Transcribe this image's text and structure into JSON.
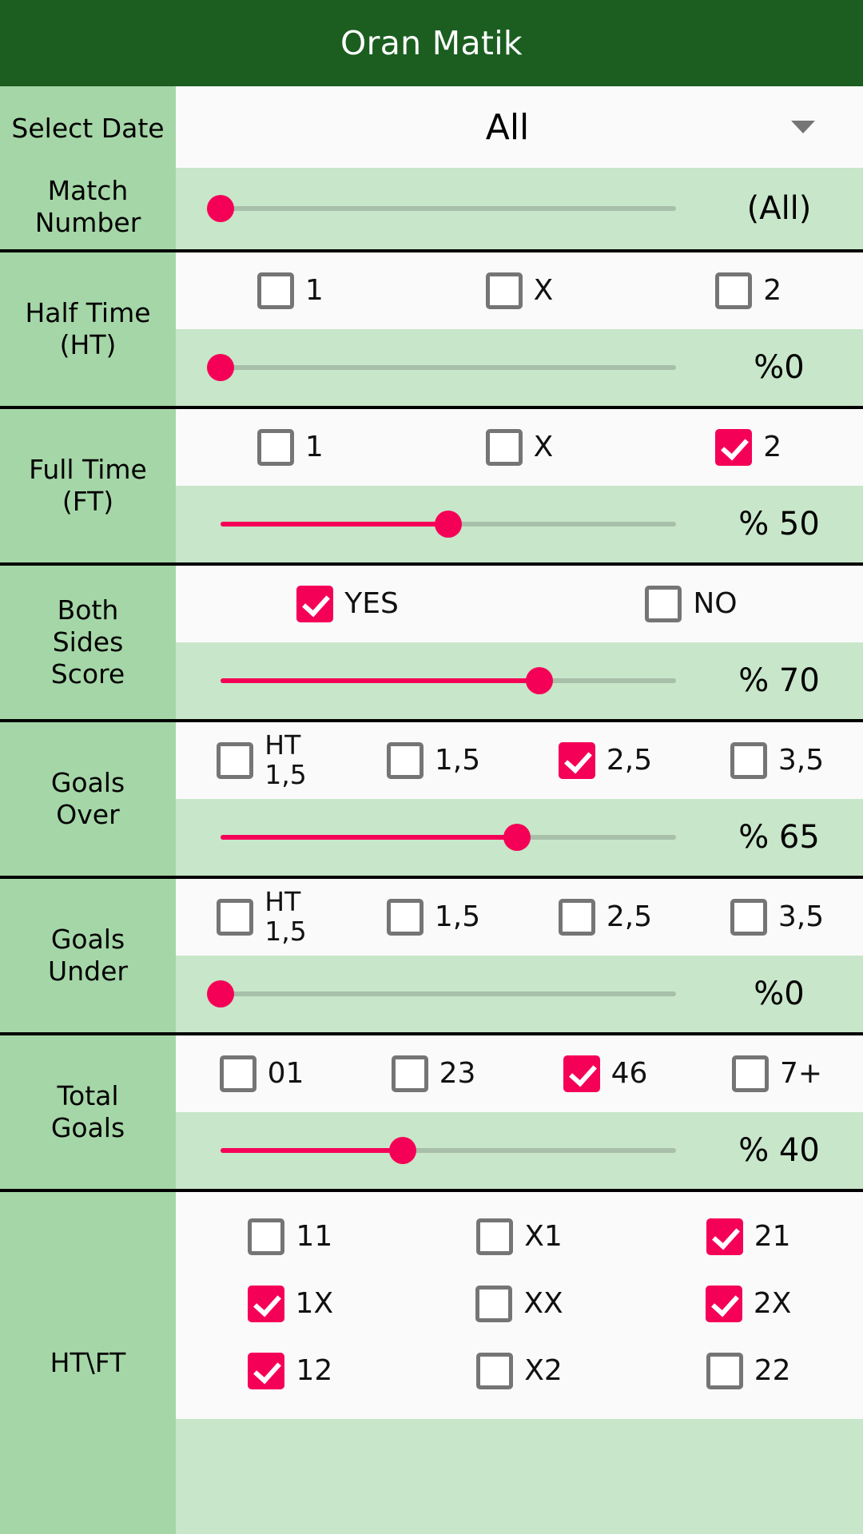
{
  "appbar": {
    "title": "Oran Matik"
  },
  "sections": {
    "select_date": {
      "label": "Select\nDate",
      "dropdown_value": "All",
      "caret_icon": "chevron-down-icon"
    },
    "match_number": {
      "label": "Match\nNumber",
      "slider_value_text": "(All)",
      "slider_percent": 0
    },
    "half_time": {
      "label": "Half Time\n(HT)",
      "options": [
        {
          "label": "1",
          "checked": false
        },
        {
          "label": "X",
          "checked": false
        },
        {
          "label": "2",
          "checked": false
        }
      ],
      "slider_value_text": "%0",
      "slider_percent": 0
    },
    "full_time": {
      "label": "Full Time\n(FT)",
      "options": [
        {
          "label": "1",
          "checked": false
        },
        {
          "label": "X",
          "checked": false
        },
        {
          "label": "2",
          "checked": true
        }
      ],
      "slider_value_text": "% 50",
      "slider_percent": 50
    },
    "both_sides_score": {
      "label": "Both\nSides\nScore",
      "options": [
        {
          "label": "YES",
          "checked": true
        },
        {
          "label": "NO",
          "checked": false
        }
      ],
      "slider_value_text": "% 70",
      "slider_percent": 70
    },
    "goals_over": {
      "label": "Goals\nOver",
      "options": [
        {
          "label": "HT\n1,5",
          "checked": false
        },
        {
          "label": "1,5",
          "checked": false
        },
        {
          "label": "2,5",
          "checked": true
        },
        {
          "label": "3,5",
          "checked": false
        }
      ],
      "slider_value_text": "% 65",
      "slider_percent": 65
    },
    "goals_under": {
      "label": "Goals\nUnder",
      "options": [
        {
          "label": "HT\n1,5",
          "checked": false
        },
        {
          "label": "1,5",
          "checked": false
        },
        {
          "label": "2,5",
          "checked": false
        },
        {
          "label": "3,5",
          "checked": false
        }
      ],
      "slider_value_text": "%0",
      "slider_percent": 0
    },
    "total_goals": {
      "label": "Total\nGoals",
      "options": [
        {
          "label": "01",
          "checked": false
        },
        {
          "label": "23",
          "checked": false
        },
        {
          "label": "46",
          "checked": true
        },
        {
          "label": "7+",
          "checked": false
        }
      ],
      "slider_value_text": "% 40",
      "slider_percent": 40
    },
    "ht_ft": {
      "label": "HT\\FT",
      "rows": [
        [
          {
            "label": "11",
            "checked": false
          },
          {
            "label": "X1",
            "checked": false
          },
          {
            "label": "21",
            "checked": true
          }
        ],
        [
          {
            "label": "1X",
            "checked": true
          },
          {
            "label": "XX",
            "checked": false
          },
          {
            "label": "2X",
            "checked": true
          }
        ],
        [
          {
            "label": "12",
            "checked": true
          },
          {
            "label": "X2",
            "checked": false
          },
          {
            "label": "22",
            "checked": false
          }
        ]
      ]
    }
  },
  "colors": {
    "appbar_green": "#1B5E20",
    "label_green": "#A5D6A7",
    "slider_row_green": "#C8E6C9",
    "checkbox_row_bg": "#FAFAFA",
    "accent_pink": "#F50057",
    "checkbox_border": "#757575",
    "divider_black": "#000000"
  }
}
